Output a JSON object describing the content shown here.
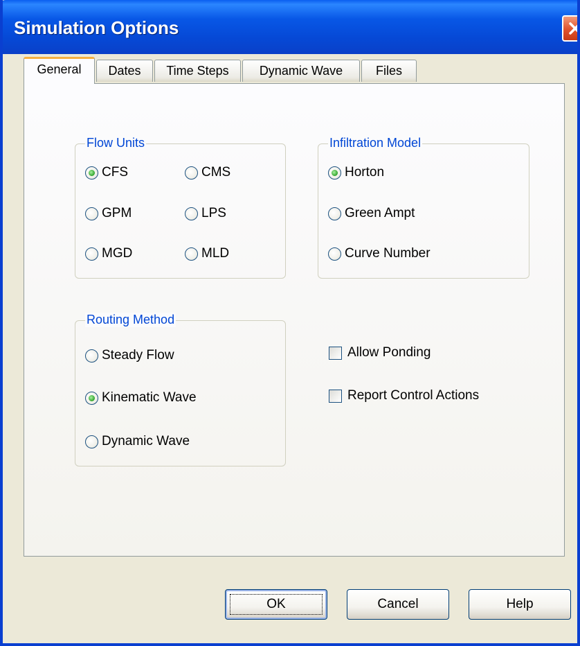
{
  "window": {
    "title": "Simulation Options"
  },
  "tabs": [
    "General",
    "Dates",
    "Time Steps",
    "Dynamic Wave",
    "Files"
  ],
  "active_tab": "General",
  "flow_units": {
    "title": "Flow Units",
    "options": [
      "CFS",
      "CMS",
      "GPM",
      "LPS",
      "MGD",
      "MLD"
    ],
    "selected": "CFS"
  },
  "infiltration_model": {
    "title": "Infiltration Model",
    "options": [
      "Horton",
      "Green Ampt",
      "Curve Number"
    ],
    "selected": "Horton"
  },
  "routing_method": {
    "title": "Routing Method",
    "options": [
      "Steady Flow",
      "Kinematic Wave",
      "Dynamic Wave"
    ],
    "selected": "Kinematic Wave"
  },
  "checkboxes": [
    {
      "label": "Allow Ponding",
      "checked": false
    },
    {
      "label": "Report Control Actions",
      "checked": false
    }
  ],
  "buttons": {
    "ok": "OK",
    "cancel": "Cancel",
    "help": "Help"
  },
  "colors": {
    "titlebar": "#0a5ef0",
    "group_title": "#0046d5",
    "radio_selected": "#2fa32a",
    "active_tab_accent": "#f6b040"
  }
}
